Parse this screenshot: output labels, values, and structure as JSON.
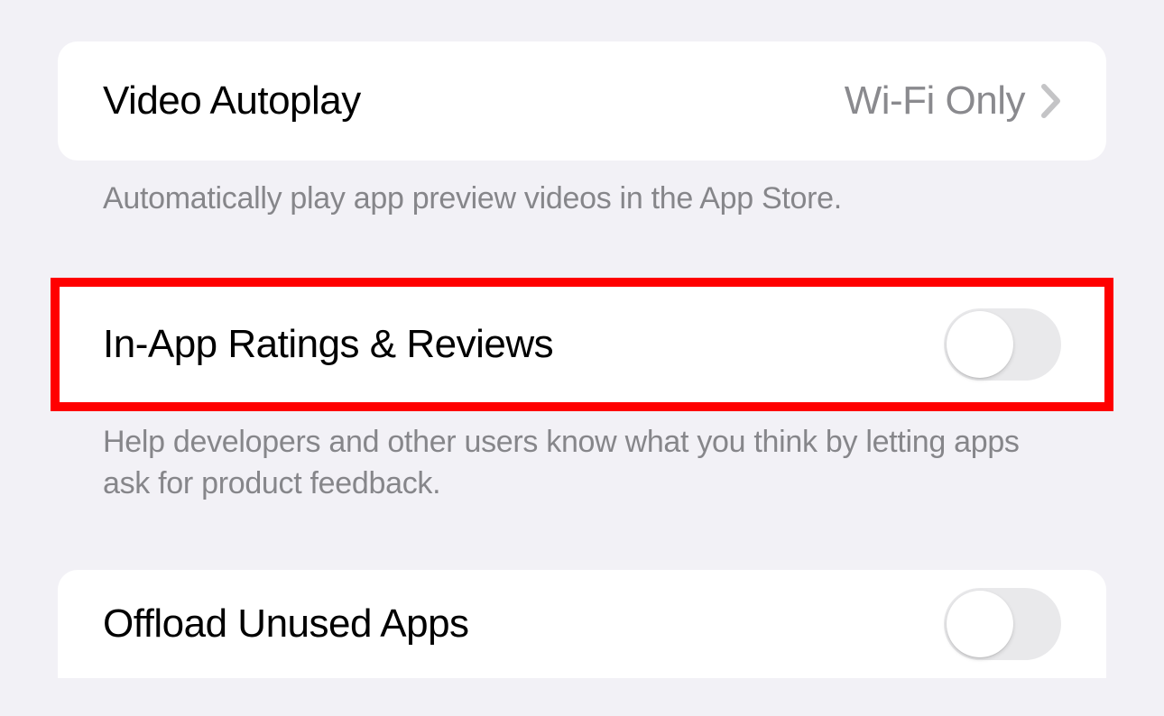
{
  "settings": {
    "video_autoplay": {
      "label": "Video Autoplay",
      "value": "Wi-Fi Only",
      "footer": "Automatically play app preview videos in the App Store."
    },
    "in_app_ratings": {
      "label": "In-App Ratings & Reviews",
      "enabled": false,
      "footer": "Help developers and other users know what you think by letting apps ask for product feedback."
    },
    "offload_unused": {
      "label": "Offload Unused Apps",
      "enabled": false
    }
  }
}
